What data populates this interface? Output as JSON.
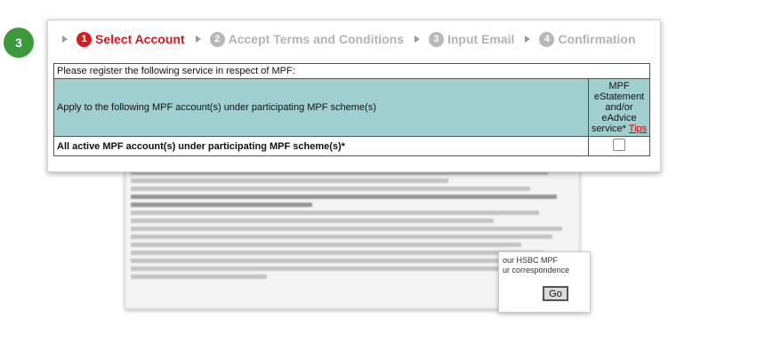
{
  "step_badge": "3",
  "stepper": [
    {
      "num": "1",
      "label": "Select Account"
    },
    {
      "num": "2",
      "label": "Accept Terms and Conditions"
    },
    {
      "num": "3",
      "label": "Input Email"
    },
    {
      "num": "4",
      "label": "Confirmation"
    }
  ],
  "table": {
    "intro": "Please register the following service in respect of MPF:",
    "apply_label": "Apply to the following MPF account(s) under participating MPF scheme(s)",
    "service_header": "MPF eStatement and/or eAdvice service*",
    "tips_link": "Tips",
    "account_row_label": "All active MPF account(s) under participating MPF scheme(s)*",
    "account_checked": false
  },
  "popup": {
    "line1": "our HSBC MPF",
    "line2": "ur correspondence",
    "go_label": "Go"
  }
}
